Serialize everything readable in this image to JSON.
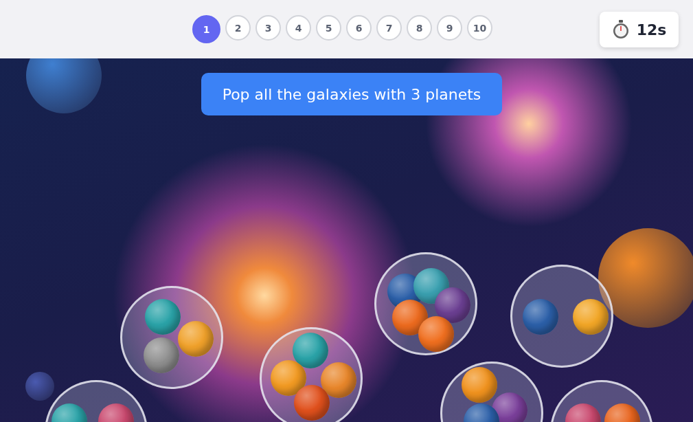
{
  "levels": [
    {
      "label": "1",
      "selected": true
    },
    {
      "label": "2",
      "selected": false
    },
    {
      "label": "3",
      "selected": false
    },
    {
      "label": "4",
      "selected": false
    },
    {
      "label": "5",
      "selected": false
    },
    {
      "label": "6",
      "selected": false
    },
    {
      "label": "7",
      "selected": false
    },
    {
      "label": "8",
      "selected": false
    },
    {
      "label": "9",
      "selected": false
    },
    {
      "label": "10",
      "selected": false
    }
  ],
  "timer": {
    "value": "12s"
  },
  "instruction": "Pop all the galaxies with 3 planets",
  "bubbles": [
    {
      "planets": [
        {
          "color": "#2aa3a8"
        },
        {
          "color": "#f0a12a"
        },
        {
          "color": "#8f8f8f"
        }
      ]
    },
    {
      "planets": [
        {
          "color": "#2aa3a8"
        },
        {
          "color": "#f29a22"
        },
        {
          "color": "#e8862a"
        },
        {
          "color": "#e0501c"
        }
      ]
    },
    {
      "planets": [
        {
          "color": "#2b5fa8"
        },
        {
          "color": "#3aa0b0"
        },
        {
          "color": "#6b3f92"
        },
        {
          "color": "#ec6a1e"
        },
        {
          "color": "#f06f1f"
        }
      ]
    },
    {
      "planets": [
        {
          "color": "#2b5fa8"
        },
        {
          "color": "#f2a626"
        }
      ]
    },
    {
      "planets": [
        {
          "color": "#f0921e"
        },
        {
          "color": "#7a3f9a"
        },
        {
          "color": "#2b5fa8"
        }
      ]
    },
    {
      "planets": [
        {
          "color": "#2aa3a8"
        },
        {
          "color": "#c9486e"
        }
      ]
    },
    {
      "planets": [
        {
          "color": "#c9486e"
        },
        {
          "color": "#e8641e"
        }
      ]
    }
  ]
}
